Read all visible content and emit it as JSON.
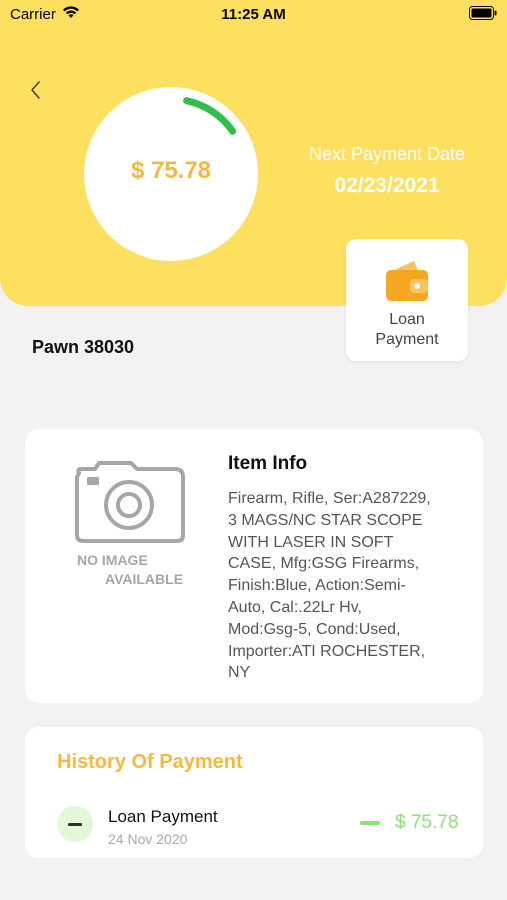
{
  "status_bar": {
    "carrier": "Carrier",
    "time": "11:25 AM"
  },
  "header": {
    "amount": "$ 75.78",
    "next_payment_label": "Next Payment Date",
    "next_payment_date": "02/23/2021",
    "progress_fraction": 0.12
  },
  "loan_payment_button": {
    "label_line1": "Loan",
    "label_line2": "Payment",
    "icon": "wallet-icon"
  },
  "pawn": {
    "title": "Pawn 38030"
  },
  "item_info": {
    "image_placeholder_line1": "NO IMAGE",
    "image_placeholder_line2": "AVAILABLE",
    "title": "Item Info",
    "description_lines": [
      "Firearm, Rifle, Ser:A287229,",
      "3 MAGS/NC STAR SCOPE",
      "WITH LASER IN SOFT",
      "CASE, Mfg:GSG Firearms,",
      "Finish:Blue, Action:Semi-",
      "Auto, Cal:.22Lr  Hv,",
      "Mod:Gsg-5, Cond:Used,",
      "Importer:ATI ROCHESTER,",
      "NY"
    ]
  },
  "history": {
    "title": "History Of Payment",
    "items": [
      {
        "title": "Loan Payment",
        "date": "24 Nov 2020",
        "amount": "$ 75.78"
      }
    ]
  },
  "colors": {
    "header_yellow": "#fde060",
    "accent_orange": "#f5b942",
    "progress_green": "#2fbf4a",
    "history_green": "#8ee07a"
  }
}
